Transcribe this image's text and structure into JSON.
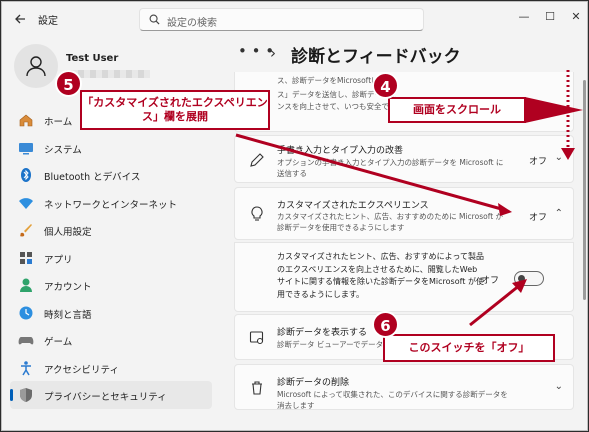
{
  "window": {
    "app_title": "設定",
    "search_placeholder": "設定の検索",
    "controls": [
      "—",
      "☐",
      "✕"
    ]
  },
  "profile": {
    "name": "Test User"
  },
  "sidebar": {
    "items": [
      {
        "label": "ホーム",
        "icon": "home-icon"
      },
      {
        "label": "システム",
        "icon": "system-icon"
      },
      {
        "label": "Bluetooth とデバイス",
        "icon": "bluetooth-icon"
      },
      {
        "label": "ネットワークとインターネット",
        "icon": "network-icon"
      },
      {
        "label": "個人用設定",
        "icon": "brush-icon"
      },
      {
        "label": "アプリ",
        "icon": "apps-icon"
      },
      {
        "label": "アカウント",
        "icon": "account-icon"
      },
      {
        "label": "時刻と言語",
        "icon": "time-language-icon"
      },
      {
        "label": "ゲーム",
        "icon": "game-icon"
      },
      {
        "label": "アクセシビリティ",
        "icon": "accessibility-icon"
      },
      {
        "label": "プライバシーとセキュリティ",
        "icon": "shield-icon",
        "active": true
      }
    ]
  },
  "breadcrumb": {
    "dots": "• • •",
    "sep": "›",
    "title": "診断とフィードバック"
  },
  "cards": {
    "top_partial_desc1": "ス、診断データをMicrosoftに送信",
    "top_partial_desc2": "ス」データを送信し、診断データを",
    "top_partial_desc3": "ンスを向上させて、いつも安全で最新",
    "handwriting": {
      "title": "手書き入力とタイプ入力の改善",
      "desc": "オプションの手書き入力とタイプ入力の診断データを Microsoft に送信する",
      "state": "オフ"
    },
    "tailored": {
      "title": "カスタマイズされたエクスペリエンス",
      "desc": "カスタマイズされたヒント、広告、おすすめのために Microsoft が診断データを使用できるようにします",
      "state": "オフ",
      "expanded_text": "カスタマイズされたヒント、広告、おすすめによって製品のエクスペリエンスを向上させるために、閲覧したWeb サイトに関する情報を除いた診断データをMicrosoft が使用できるようにします。",
      "toggle_state": "オフ"
    },
    "view_data": {
      "title": "診断データを表示する",
      "desc": "診断データ ビューアーでデータを表示します"
    },
    "delete_data": {
      "title": "診断データの削除",
      "desc": "Microsoft によって収集された、このデバイスに関する診断データを消去します"
    }
  },
  "callouts": {
    "c4": {
      "num": "4",
      "text": "画面をスクロール"
    },
    "c5": {
      "num": "5",
      "text": "「カスタマイズされたエクスペリエンス」欄を展開"
    },
    "c6": {
      "num": "6",
      "text": "このスイッチを「オフ」"
    }
  },
  "colors": {
    "accent": "#005fb8",
    "callout": "#b00020"
  }
}
